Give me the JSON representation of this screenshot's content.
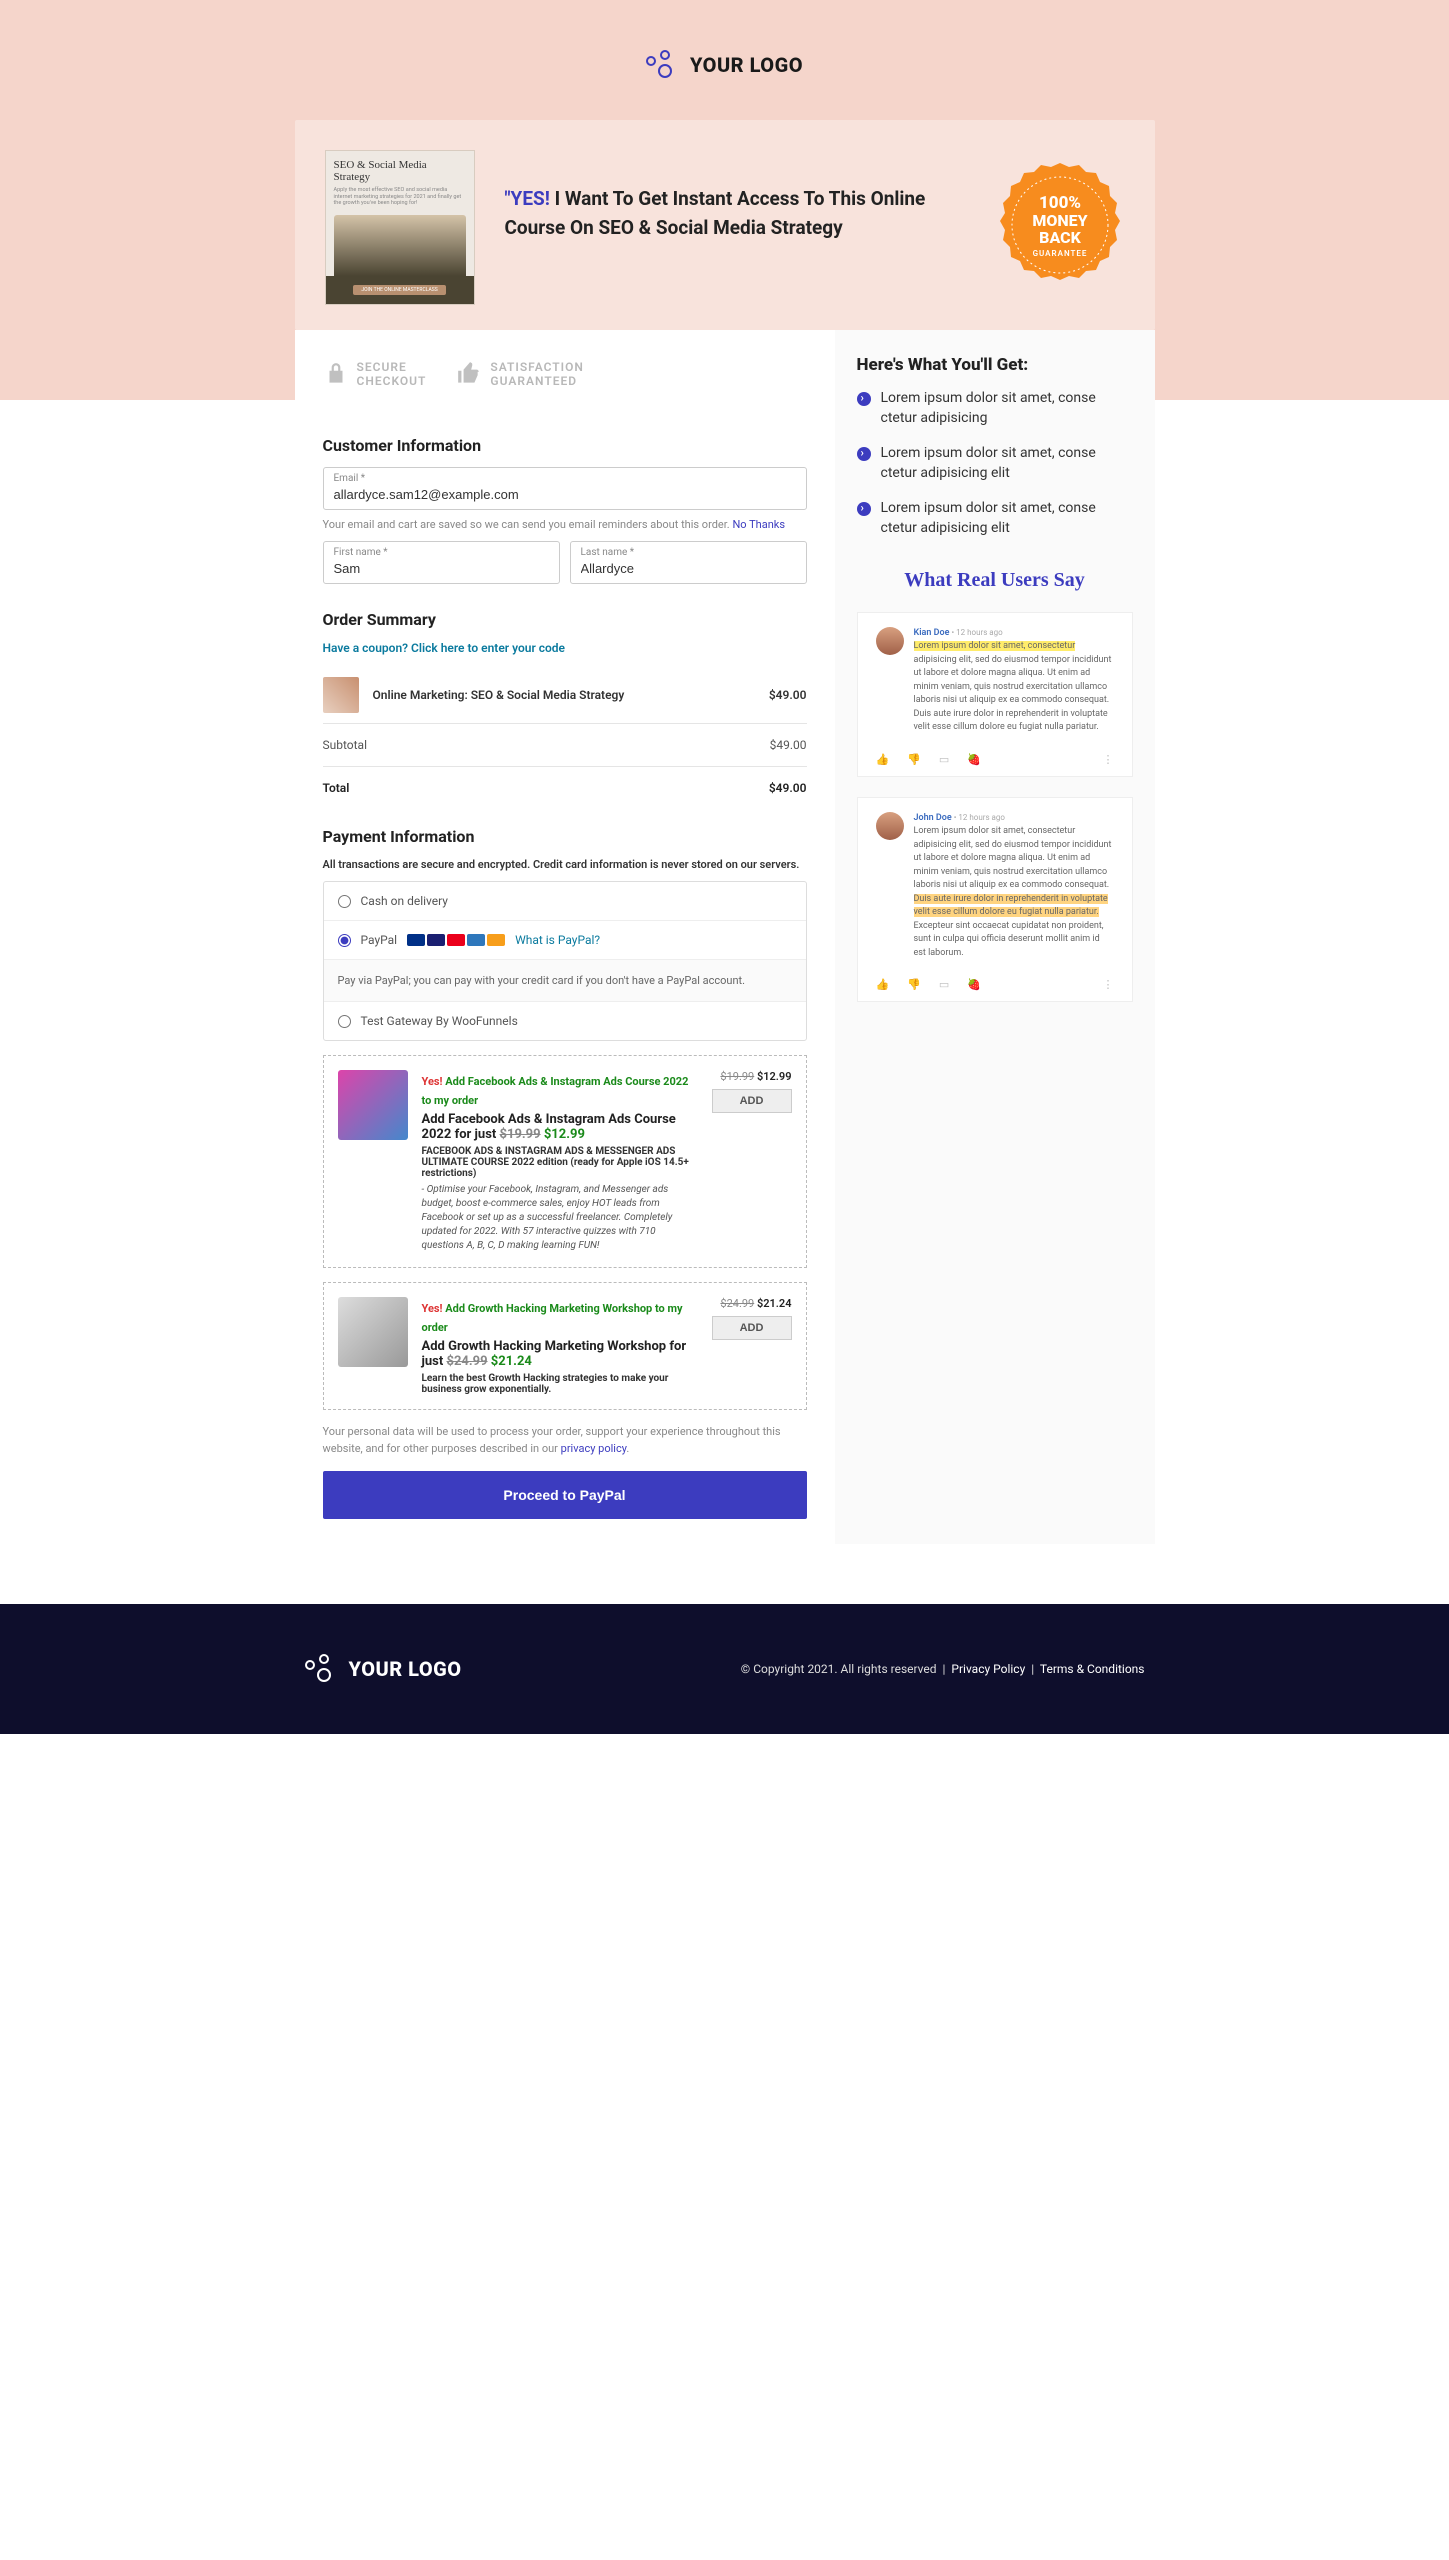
{
  "logo": {
    "text": "YOUR LOGO"
  },
  "hero": {
    "thumb_title": "SEO & Social Media Strategy",
    "thumb_sub": "Apply the most effective SEO and social media internet marketing strategies for 2021 and finally get the growth you've been hoping for!",
    "thumb_cta": "JOIN THE ONLINE MASTERCLASS",
    "yes": "\"YES!",
    "headline": " I Want To Get Instant Access To This Online Course On SEO & Social Media Strategy",
    "badge_l1": "100%",
    "badge_l2": "MONEY",
    "badge_l3": "BACK",
    "badge_l4": "GUARANTEE"
  },
  "trust": {
    "a1": "SECURE",
    "a2": "CHECKOUT",
    "b1": "SATISFACTION",
    "b2": "GUARANTEED"
  },
  "customer": {
    "heading": "Customer Information",
    "email_label": "Email *",
    "email_value": "allardyce.sam12@example.com",
    "hint": "Your email and cart are saved so we can send you email reminders about this order.",
    "no_thanks": "No Thanks",
    "fn_label": "First name *",
    "fn_value": "Sam",
    "ln_label": "Last name *",
    "ln_value": "Allardyce"
  },
  "order": {
    "heading": "Order Summary",
    "coupon": "Have a coupon? Click here to enter your code",
    "item_name": "Online Marketing: SEO & Social Media Strategy",
    "item_price": "$49.00",
    "subtotal_label": "Subtotal",
    "subtotal_value": "$49.00",
    "total_label": "Total",
    "total_value": "$49.00"
  },
  "payment": {
    "heading": "Payment Information",
    "note": "All transactions are secure and encrypted. Credit card information is never stored on our servers.",
    "cod": "Cash on delivery",
    "paypal": "PayPal",
    "what_is": "What is PayPal?",
    "paypal_desc": "Pay via PayPal; you can pay with your credit card if you don't have a PayPal account.",
    "test_gw": "Test Gateway By WooFunnels"
  },
  "bump1": {
    "yes": "Yes!",
    "yesg": " Add Facebook Ads & Instagram Ads Course 2022 to my order",
    "title": "Add Facebook Ads & Instagram Ads Course 2022 for just ",
    "old": "$19.99",
    "new": "$12.99",
    "subtitle": "FACEBOOK ADS & INSTAGRAM ADS & MESSENGER ADS ULTIMATE COURSE 2022 edition (ready for Apple iOS 14.5+ restrictions)",
    "desc": " - Optimise your Facebook, Instagram, and Messenger ads budget, boost e-commerce sales, enjoy HOT leads from Facebook or set up as a successful freelancer. Completely updated for 2022. With 57 interactive quizzes with 710 questions A, B, C, D making learning FUN!",
    "p_old": "$19.99",
    "p_new": "$12.99",
    "add": "ADD"
  },
  "bump2": {
    "yes": "Yes!",
    "yesg": " Add Growth Hacking Marketing Workshop to my order",
    "title": "Add Growth Hacking Marketing Workshop for just ",
    "old": "$24.99",
    "new": "$21.24",
    "desc": "Learn the best Growth Hacking strategies to make your business grow exponentially.",
    "p_old": "$24.99",
    "p_new": "$21.24",
    "add": "ADD"
  },
  "privacy": {
    "text": "Your personal data will be used to process your order, support your experience throughout this website, and for other purposes described in our ",
    "link": "privacy policy"
  },
  "proceed": "Proceed to PayPal",
  "right": {
    "heading": "Here's What You'll Get:",
    "b1": "Lorem ipsum dolor sit amet, conse ctetur adipisicing",
    "b2": "Lorem ipsum dolor sit amet, conse ctetur adipisicing elit",
    "b3": "Lorem ipsum dolor sit amet, conse ctetur adipisicing elit",
    "test_heading": "What Real Users Say"
  },
  "rev1": {
    "who": "Kian Doe",
    "ago": " • 12 hours ago",
    "hl": "Lorem ipsum dolor sit amet, consectetur",
    "body": " adipisicing elit, sed do eiusmod tempor incididunt ut labore et dolore magna aliqua. Ut enim ad minim veniam, quis nostrud exercitation ullamco laboris nisi ut aliquip ex ea commodo consequat. Duis aute irure dolor in reprehenderit in voluptate velit esse cillum dolore eu fugiat nulla pariatur."
  },
  "rev2": {
    "who": "John Doe",
    "ago": " • 12 hours ago",
    "pre": "Lorem ipsum dolor sit amet, consectetur adipisicing elit, sed do eiusmod tempor incididunt ut labore et dolore magna aliqua. Ut enim ad minim veniam, quis nostrud exercitation ullamco laboris nisi ut aliquip ex ea commodo consequat. ",
    "hl": "Duis aute irure dolor in reprehenderit in voluptate velit esse cillum dolore eu fugiat nulla pariatur.",
    "post": " Excepteur sint occaecat cupidatat non proident, sunt in culpa qui officia deserunt mollit anim id est laborum."
  },
  "footer": {
    "copy": "© Copyright 2021. All rights reserved",
    "pp": "Privacy Policy",
    "tc": "Terms & Conditions"
  }
}
